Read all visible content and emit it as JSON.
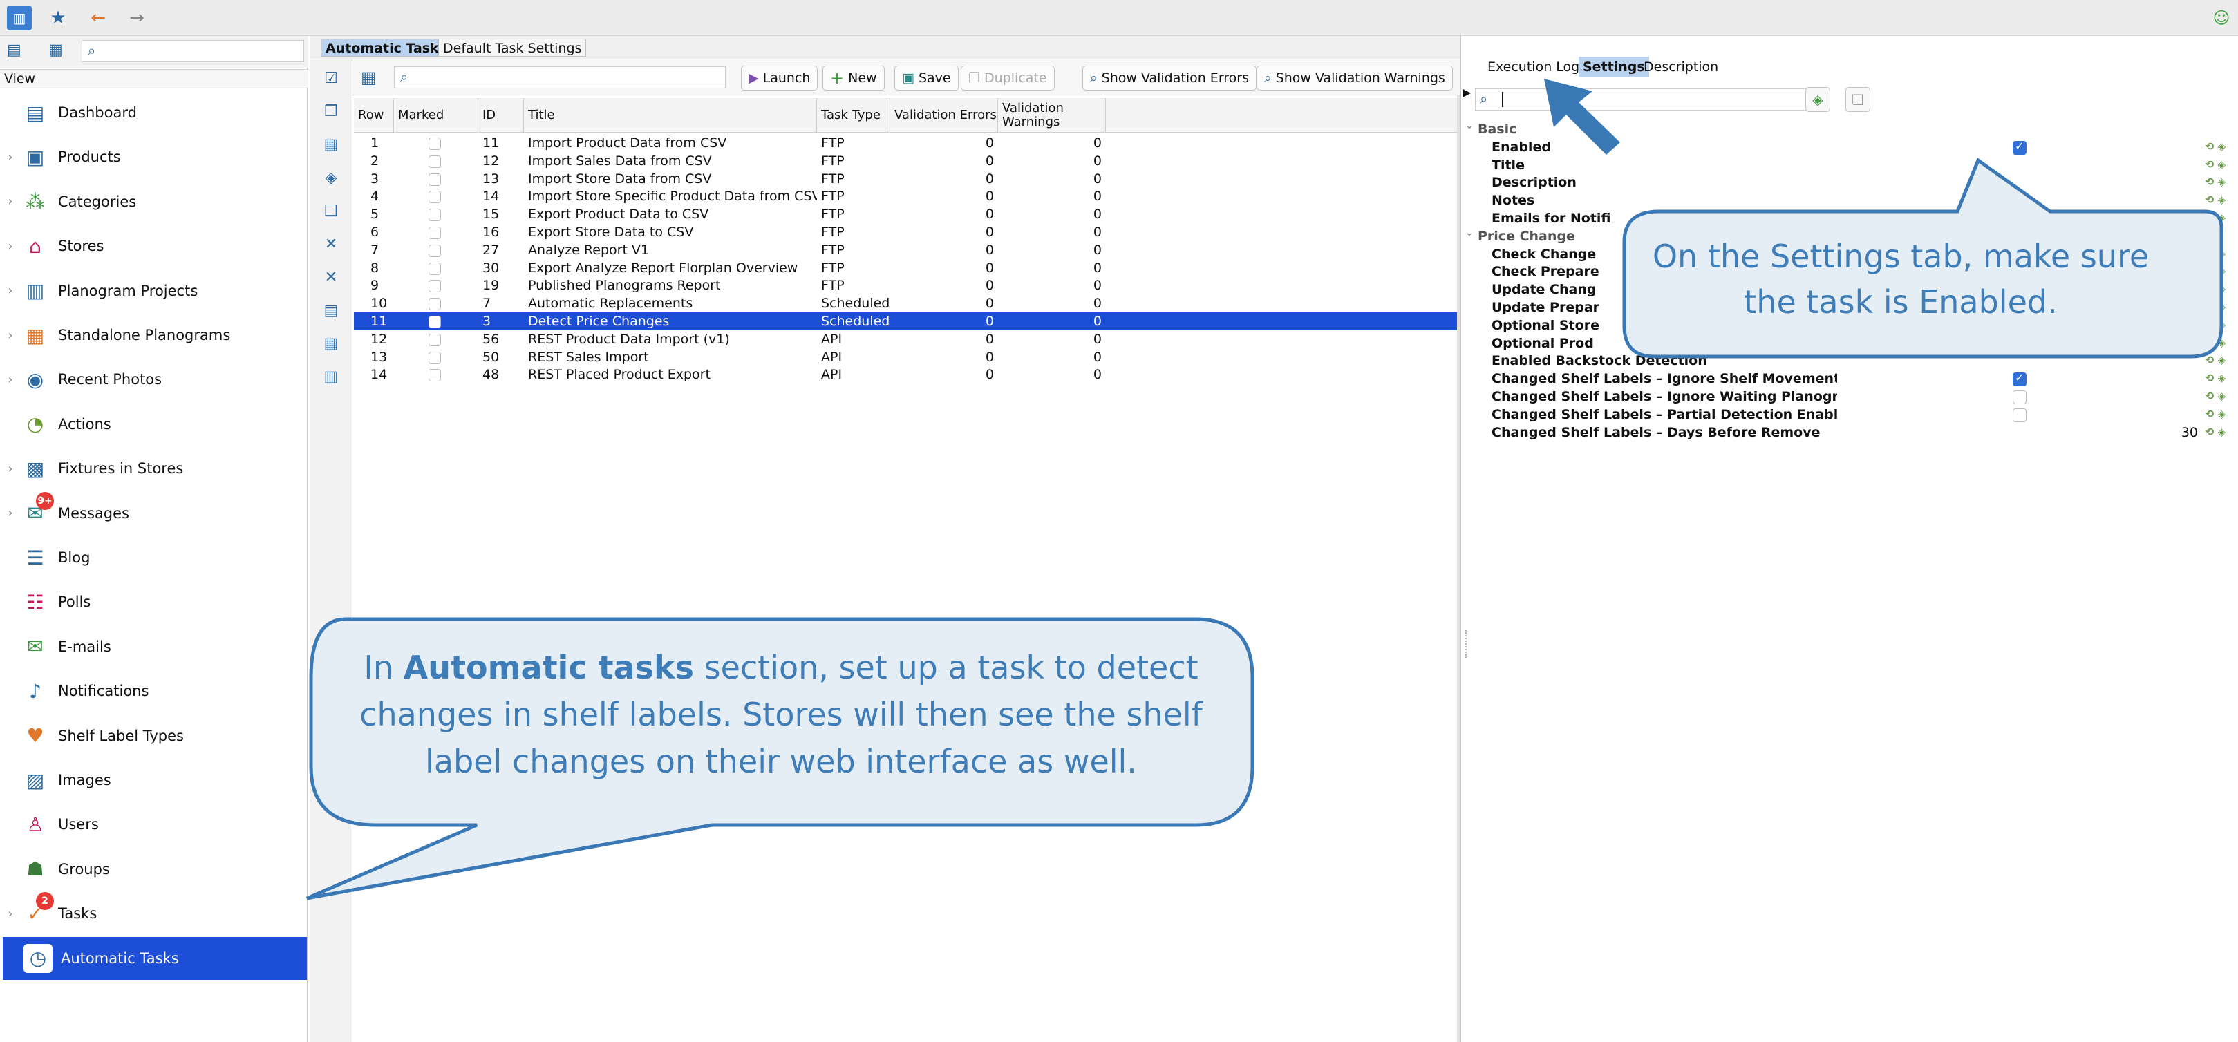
{
  "left_nav": {
    "view_label": "View",
    "items": [
      {
        "label": "Dashboard",
        "icon": "dashboard-icon",
        "chevron": false
      },
      {
        "label": "Products",
        "icon": "products-icon",
        "chevron": true
      },
      {
        "label": "Categories",
        "icon": "categories-icon",
        "chevron": true
      },
      {
        "label": "Stores",
        "icon": "stores-icon",
        "chevron": true
      },
      {
        "label": "Planogram Projects",
        "icon": "planogram-projects-icon",
        "chevron": true
      },
      {
        "label": "Standalone Planograms",
        "icon": "standalone-planograms-icon",
        "chevron": true
      },
      {
        "label": "Recent Photos",
        "icon": "camera-icon",
        "chevron": true
      },
      {
        "label": "Actions",
        "icon": "actions-icon",
        "chevron": false
      },
      {
        "label": "Fixtures in Stores",
        "icon": "fixtures-icon",
        "chevron": true
      },
      {
        "label": "Messages",
        "icon": "messages-icon",
        "chevron": true,
        "badge": "9+"
      },
      {
        "label": "Blog",
        "icon": "blog-icon",
        "chevron": false
      },
      {
        "label": "Polls",
        "icon": "polls-icon",
        "chevron": false
      },
      {
        "label": "E-mails",
        "icon": "email-icon",
        "chevron": false
      },
      {
        "label": "Notifications",
        "icon": "notifications-icon",
        "chevron": false
      },
      {
        "label": "Shelf Label Types",
        "icon": "shelf-label-icon",
        "chevron": false
      },
      {
        "label": "Images",
        "icon": "images-icon",
        "chevron": false
      },
      {
        "label": "Users",
        "icon": "users-icon",
        "chevron": false
      },
      {
        "label": "Groups",
        "icon": "groups-icon",
        "chevron": false
      },
      {
        "label": "Tasks",
        "icon": "tasks-icon",
        "chevron": true,
        "badge": "2"
      },
      {
        "label": "Automatic Tasks",
        "icon": "automatic-tasks-icon",
        "chevron": false,
        "active": true
      }
    ]
  },
  "main": {
    "tabs": [
      "Automatic Tasks",
      "Default Task Settings"
    ],
    "toolbar": {
      "launch": "Launch",
      "new": "New",
      "save": "Save",
      "duplicate": "Duplicate",
      "show_errors": "Show Validation Errors",
      "show_warnings": "Show Validation Warnings"
    },
    "columns": [
      "Row",
      "Marked",
      "ID",
      "Title",
      "Task Type",
      "Validation Errors",
      "Validation Warnings"
    ],
    "rows": [
      {
        "row": "1",
        "id": "11",
        "title": "Import Product Data from CSV",
        "type": "FTP",
        "errors": "0",
        "warnings": "0"
      },
      {
        "row": "2",
        "id": "12",
        "title": "Import Sales Data from CSV",
        "type": "FTP",
        "errors": "0",
        "warnings": "0"
      },
      {
        "row": "3",
        "id": "13",
        "title": "Import Store Data from CSV",
        "type": "FTP",
        "errors": "0",
        "warnings": "0"
      },
      {
        "row": "4",
        "id": "14",
        "title": "Import Store Specific Product Data from CSV",
        "type": "FTP",
        "errors": "0",
        "warnings": "0"
      },
      {
        "row": "5",
        "id": "15",
        "title": "Export Product Data to CSV",
        "type": "FTP",
        "errors": "0",
        "warnings": "0"
      },
      {
        "row": "6",
        "id": "16",
        "title": "Export Store Data to CSV",
        "type": "FTP",
        "errors": "0",
        "warnings": "0"
      },
      {
        "row": "7",
        "id": "27",
        "title": "Analyze Report V1",
        "type": "FTP",
        "errors": "0",
        "warnings": "0"
      },
      {
        "row": "8",
        "id": "30",
        "title": "Export Analyze Report Florplan Overview",
        "type": "FTP",
        "errors": "0",
        "warnings": "0"
      },
      {
        "row": "9",
        "id": "19",
        "title": "Published Planograms Report",
        "type": "FTP",
        "errors": "0",
        "warnings": "0"
      },
      {
        "row": "10",
        "id": "7",
        "title": "Automatic Replacements",
        "type": "Scheduled",
        "errors": "0",
        "warnings": "0"
      },
      {
        "row": "11",
        "id": "3",
        "title": "Detect Price Changes",
        "type": "Scheduled",
        "errors": "0",
        "warnings": "0",
        "selected": true
      },
      {
        "row": "12",
        "id": "56",
        "title": "REST Product Data Import (v1)",
        "type": "API",
        "errors": "0",
        "warnings": "0"
      },
      {
        "row": "13",
        "id": "50",
        "title": "REST Sales Import",
        "type": "API",
        "errors": "0",
        "warnings": "0"
      },
      {
        "row": "14",
        "id": "48",
        "title": "REST Placed Product Export",
        "type": "API",
        "errors": "0",
        "warnings": "0"
      }
    ]
  },
  "right": {
    "tabs": [
      "Execution Log",
      "Settings",
      "Description"
    ],
    "selected_tab": "Settings",
    "properties": [
      {
        "label": "Basic",
        "group": true
      },
      {
        "label": "Enabled",
        "check": "on"
      },
      {
        "label": "Title"
      },
      {
        "label": "Description"
      },
      {
        "label": "Notes"
      },
      {
        "label": "Emails for Notifi"
      },
      {
        "label": "Price Change",
        "group": true
      },
      {
        "label": "Check Change"
      },
      {
        "label": "Check Prepare"
      },
      {
        "label": "Update Chang"
      },
      {
        "label": "Update Prepar"
      },
      {
        "label": "Optional Store"
      },
      {
        "label": "Optional Prod"
      },
      {
        "label": "Enabled Backstock Detection"
      },
      {
        "label": "Changed Shelf Labels – Ignore Shelf Movement",
        "check": "on"
      },
      {
        "label": "Changed Shelf Labels – Ignore Waiting Planogr...",
        "check": "off"
      },
      {
        "label": "Changed Shelf Labels – Partial Detection Enabl...",
        "check": "off"
      },
      {
        "label": "Changed Shelf Labels – Days Before Remove",
        "value": "30"
      }
    ]
  },
  "callouts": {
    "settings": "On the Settings tab, make sure the task is Enabled.",
    "automatic_pre": "In ",
    "automatic_bold": "Automatic tasks",
    "automatic_post": " section, set up a task to detect changes in shelf labels. Stores will then see the shelf label changes on their web interface as well."
  },
  "colors": {
    "selection": "#1d4ed8",
    "callout_border": "#3a78b6",
    "callout_fill": "#e6eef5",
    "callout_text": "#3e7db8"
  }
}
